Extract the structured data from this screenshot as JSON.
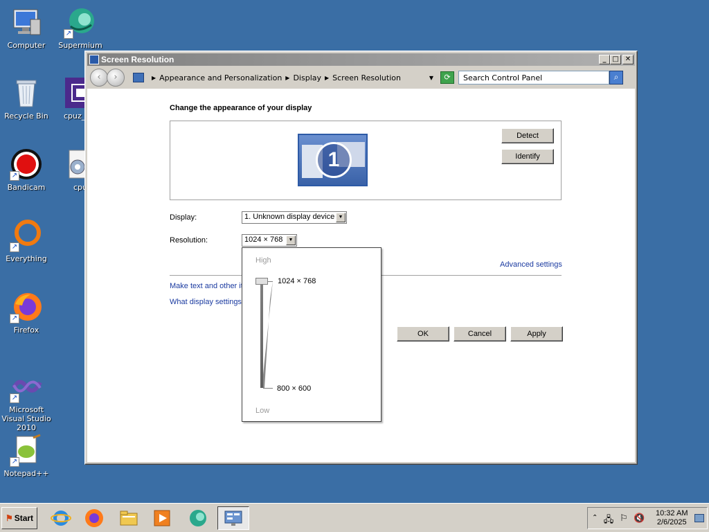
{
  "desktop": {
    "icons": [
      {
        "label": "Computer",
        "icon": "computer-icon"
      },
      {
        "label": "Supermium",
        "icon": "supermium-icon"
      },
      {
        "label": "Recycle Bin",
        "icon": "recycle-bin-icon"
      },
      {
        "label": "cpuz_",
        "icon": "cpuz-icon"
      },
      {
        "label": "Bandicam",
        "icon": "bandicam-icon"
      },
      {
        "label": "cpu",
        "icon": "settings-gear-icon"
      },
      {
        "label": "Everything",
        "icon": "everything-icon"
      },
      {
        "label": "Firefox",
        "icon": "firefox-icon"
      },
      {
        "label": "Microsoft Visual Studio 2010",
        "icon": "visual-studio-icon"
      },
      {
        "label": "Notepad++",
        "icon": "notepad-plus-plus-icon"
      }
    ]
  },
  "window": {
    "title": "Screen Resolution",
    "controls": {
      "minimize": "_",
      "maximize": "□",
      "close": "✕"
    },
    "breadcrumb": [
      "Appearance and Personalization",
      "Display",
      "Screen Resolution"
    ],
    "search_placeholder": "Search Control Panel"
  },
  "content": {
    "heading": "Change the appearance of your display",
    "monitor_number": "1",
    "detect_label": "Detect",
    "identify_label": "Identify",
    "display_label": "Display:",
    "display_value": "1. Unknown display device",
    "resolution_label": "Resolution:",
    "resolution_value": "1024 × 768",
    "advanced_link": "Advanced settings",
    "link_text_size": "Make text and other it",
    "link_display_settings": "What display settings",
    "ok_label": "OK",
    "cancel_label": "Cancel",
    "apply_label": "Apply"
  },
  "resolution_popup": {
    "high_label": "High",
    "low_label": "Low",
    "max_value": "1024 × 768",
    "min_value": "800 × 600",
    "selected": "1024 × 768"
  },
  "taskbar": {
    "start_label": "Start",
    "apps": [
      "internet-explorer-icon",
      "firefox-icon",
      "file-explorer-icon",
      "media-player-icon",
      "supermium-icon",
      "control-panel-icon"
    ],
    "clock_time": "10:32 AM",
    "clock_date": "2/6/2025"
  }
}
